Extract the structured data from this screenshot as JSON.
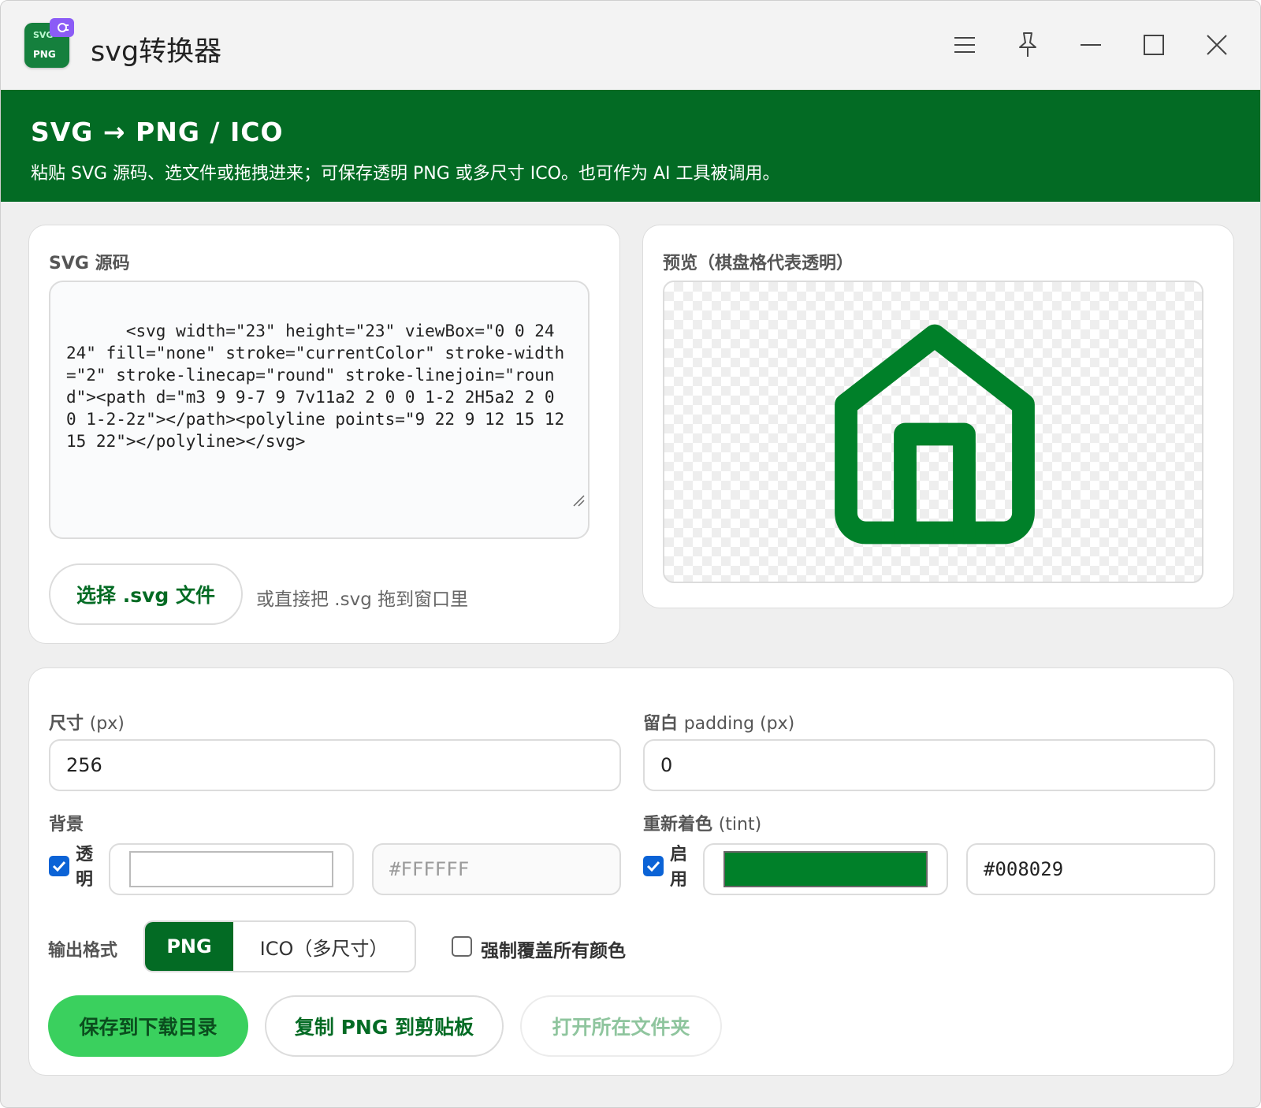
{
  "window": {
    "title": "svg转换器",
    "icon_text_top": "SVG",
    "icon_text_bottom": "PNG"
  },
  "banner": {
    "heading": "SVG → PNG / ICO",
    "subtitle": "粘贴 SVG 源码、选文件或拖拽进来；可保存透明 PNG 或多尺寸 ICO。也可作为 AI 工具被调用。"
  },
  "source": {
    "label": "SVG 源码",
    "code": "<svg width=\"23\" height=\"23\" viewBox=\"0 0 24 24\" fill=\"none\" stroke=\"currentColor\" stroke-width=\"2\" stroke-linecap=\"round\" stroke-linejoin=\"round\"><path d=\"m3 9 9-7 9 7v11a2 2 0 0 1-2 2H5a2 2 0 0 1-2-2z\"></path><polyline points=\"9 22 9 12 15 12 15 22\"></polyline></svg>",
    "choose_button": "选择 .svg 文件",
    "drop_hint": "或直接把 .svg 拖到窗口里"
  },
  "preview": {
    "label": "预览（棋盘格代表透明）"
  },
  "settings": {
    "size_label": "尺寸",
    "size_unit": "(px)",
    "size_value": "256",
    "padding_label": "留白",
    "padding_unit": "padding (px)",
    "padding_value": "0",
    "background_label": "背景",
    "transparent_label_1": "透",
    "transparent_label_2": "明",
    "transparent_checked": true,
    "bg_color_hex": "#FFFFFF",
    "tint_label": "重新着色",
    "tint_unit": "(tint)",
    "tint_enable_1": "启",
    "tint_enable_2": "用",
    "tint_checked": true,
    "tint_color_hex": "#008029",
    "format_label": "输出格式",
    "format_png": "PNG",
    "format_ico": "ICO（多尺寸）",
    "format_selected": "PNG",
    "force_override_label": "强制覆盖所有颜色",
    "force_override_checked": false
  },
  "actions": {
    "save": "保存到下载目录",
    "copy": "复制 PNG 到剪贴板",
    "open_folder": "打开所在文件夹"
  },
  "colors": {
    "banner": "#036b24",
    "accent": "#008029",
    "save_button": "#3ad05e",
    "checkbox": "#0b63d6"
  }
}
